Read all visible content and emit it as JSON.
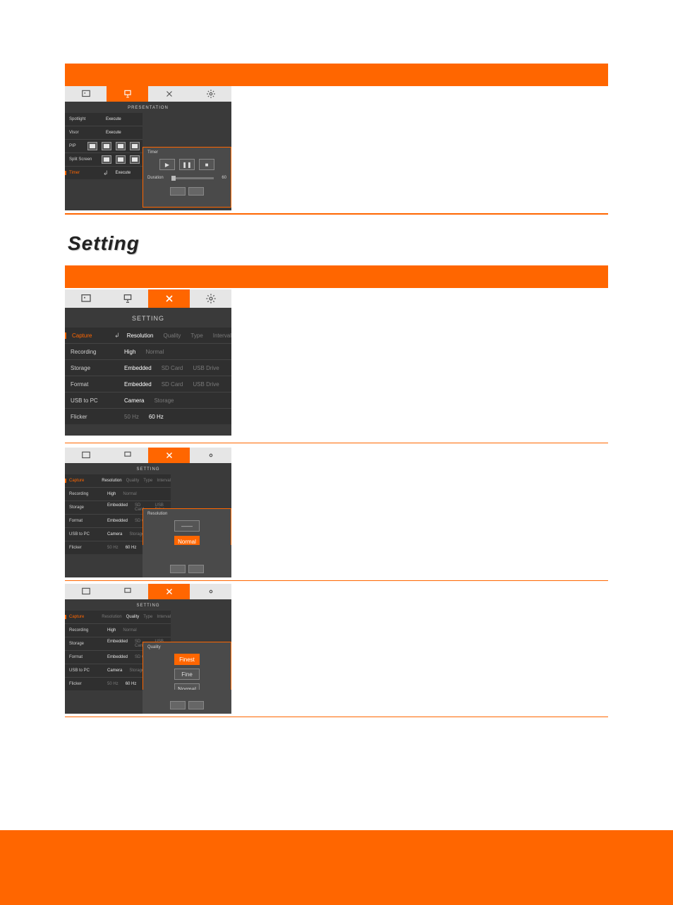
{
  "section_heading": "Setting",
  "shot_presentation": {
    "title": "PRESENTATION",
    "rows": {
      "spotlight": {
        "label": "Spotlight",
        "value": "Execute"
      },
      "visor": {
        "label": "Visor",
        "value": "Execute"
      },
      "pip": {
        "label": "PIP"
      },
      "splitscreen": {
        "label": "Split Screen"
      },
      "timer": {
        "label": "Timer",
        "value": "Execute"
      }
    },
    "popup": {
      "title": "Timer",
      "duration_label": "Duration",
      "duration_value": "60"
    }
  },
  "shot_setting_main": {
    "title": "SETTING",
    "rows": {
      "capture": {
        "label": "Capture",
        "cols": [
          "Resolution",
          "Quality",
          "Type",
          "Interval"
        ],
        "selected": true
      },
      "recording": {
        "label": "Recording",
        "cols": [
          "High",
          "Normal"
        ],
        "on_index": 0
      },
      "storage": {
        "label": "Storage",
        "cols": [
          "Embedded",
          "SD Card",
          "USB Drive"
        ],
        "on_index": 0
      },
      "format": {
        "label": "Format",
        "cols": [
          "Embedded",
          "SD Card",
          "USB Drive"
        ],
        "on_index": 0
      },
      "usb": {
        "label": "USB to PC",
        "cols": [
          "Camera",
          "Storage"
        ],
        "on_index": 0
      },
      "flicker": {
        "label": "Flicker",
        "cols": [
          "50 Hz",
          "60 Hz"
        ],
        "on_index": 1
      }
    }
  },
  "shot_setting_resolution": {
    "title": "SETTING",
    "rows": {
      "capture": {
        "label": "Capture",
        "cols": [
          "Resolution",
          "Quality",
          "Type",
          "Interval"
        ],
        "on_index": 0
      },
      "recording": {
        "label": "Recording",
        "cols": [
          "High",
          "Normal"
        ],
        "on_index": 0
      },
      "storage": {
        "label": "Storage",
        "cols": [
          "Embedded",
          "SD Card",
          "USB Drive"
        ],
        "on_index": 0
      },
      "format": {
        "label": "Format",
        "cols": [
          "Embedded",
          "SD Card"
        ],
        "on_index": 0
      },
      "usb": {
        "label": "USB to PC",
        "cols": [
          "Camera",
          "Storage"
        ],
        "on_index": 0
      },
      "flicker": {
        "label": "Flicker",
        "cols": [
          "50 Hz",
          "60 Hz"
        ],
        "on_index": 1
      }
    },
    "popup": {
      "title": "Resolution",
      "options": [
        "——",
        "Normal"
      ]
    }
  },
  "shot_setting_quality": {
    "title": "SETTING",
    "rows": {
      "capture": {
        "label": "Capture",
        "cols": [
          "Resolution",
          "Quality",
          "Type",
          "Interval"
        ],
        "on_index": 1
      },
      "recording": {
        "label": "Recording",
        "cols": [
          "High",
          "Normal"
        ],
        "on_index": 0
      },
      "storage": {
        "label": "Storage",
        "cols": [
          "Embedded",
          "SD Card",
          "USB Drive"
        ],
        "on_index": 0
      },
      "format": {
        "label": "Format",
        "cols": [
          "Embedded",
          "SD Card"
        ],
        "on_index": 0
      },
      "usb": {
        "label": "USB to PC",
        "cols": [
          "Camera",
          "Storage"
        ],
        "on_index": 0
      },
      "flicker": {
        "label": "Flicker",
        "cols": [
          "50 Hz",
          "60 Hz"
        ],
        "on_index": 1
      }
    },
    "popup": {
      "title": "Quality",
      "options": [
        "Finest",
        "Fine",
        "Normal"
      ]
    }
  }
}
